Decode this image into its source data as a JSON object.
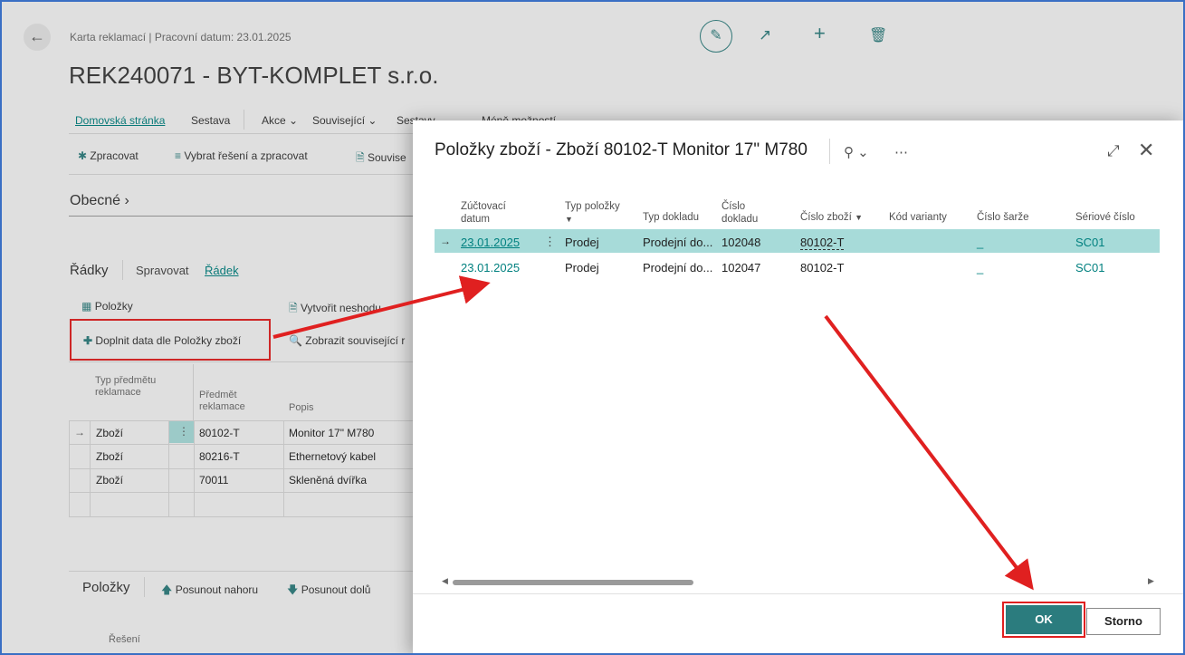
{
  "page": {
    "breadcrumb": "Karta reklamací | Pracovní datum: 23.01.2025",
    "title": "REK240071 - BYT-KOMPLET s.r.o.",
    "nav": [
      "Domovská stránka",
      "Sestava",
      "Akce",
      "Související",
      "Sestavy",
      "Méně možností"
    ],
    "actions": [
      "Zpracovat",
      "Vybrat řešení a zpracovat",
      "Souvise"
    ],
    "section_general": "Obecné",
    "lines_title": "Řádky",
    "lines_tabs": [
      "Spravovat",
      "Řádek"
    ],
    "lines_actions": {
      "items": "Položky",
      "create_nonconformity": "Vytvořit neshodu",
      "fill_data": "Doplnit data dle Položky zboží",
      "show_related": "Zobrazit související r"
    },
    "table": {
      "headers": [
        "Typ předmětu reklamace",
        "Předmět reklamace",
        "Popis"
      ],
      "rows": [
        {
          "type": "Zboží",
          "subject": "80102-T",
          "desc": "Monitor 17\" M780"
        },
        {
          "type": "Zboží",
          "subject": "80216-T",
          "desc": "Ethernetový kabel"
        },
        {
          "type": "Zboží",
          "subject": "70011",
          "desc": "Skleněná dvířka"
        }
      ]
    },
    "bottom": {
      "title": "Položky",
      "move_up": "Posunout nahoru",
      "move_down": "Posunout dolů",
      "col_solution": "Řešení"
    }
  },
  "dialog": {
    "title": "Položky zboží - Zboží 80102-T Monitor 17\" M780",
    "headers": {
      "posting_date_1": "Zúčtovací",
      "posting_date_2": "datum",
      "item_type": "Typ položky",
      "doc_type": "Typ dokladu",
      "doc_no_1": "Číslo",
      "doc_no_2": "dokladu",
      "item_no": "Číslo zboží",
      "variant": "Kód varianty",
      "lot": "Číslo šarže",
      "serial": "Sériové číslo"
    },
    "rows": [
      {
        "date": "23.01.2025",
        "type": "Prodej",
        "doc_type": "Prodejní do...",
        "doc_no": "102048",
        "item_no": "80102-T",
        "variant": "",
        "lot": "_",
        "serial": "SC01"
      },
      {
        "date": "23.01.2025",
        "type": "Prodej",
        "doc_type": "Prodejní do...",
        "doc_no": "102047",
        "item_no": "80102-T",
        "variant": "",
        "lot": "_",
        "serial": "SC01"
      }
    ],
    "ok": "OK",
    "cancel": "Storno"
  },
  "colors": {
    "accent": "#00807f",
    "selected_row": "#a7dbd9",
    "ok_button": "#2b7c7e",
    "annotation": "#e02020"
  }
}
